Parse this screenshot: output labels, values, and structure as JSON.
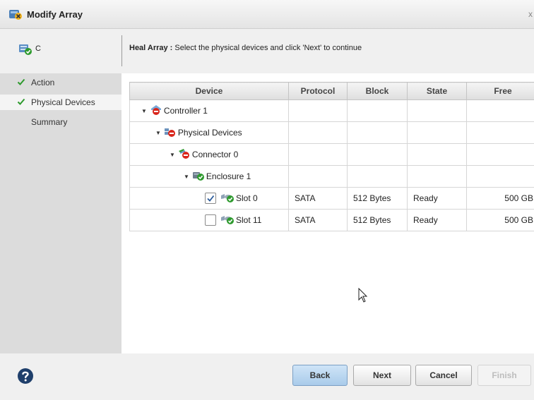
{
  "window": {
    "title": "Modify Array",
    "close_glyph": "x"
  },
  "controller": {
    "name": "C"
  },
  "instruction": {
    "bold": "Heal Array :",
    "text": " Select the physical devices and click 'Next' to continue"
  },
  "sidebar": {
    "items": [
      {
        "label": "Action",
        "checked": true
      },
      {
        "label": "Physical Devices",
        "checked": true
      },
      {
        "label": "Summary",
        "checked": false
      }
    ]
  },
  "table": {
    "columns": [
      "Device",
      "Protocol",
      "Block",
      "State",
      "Free"
    ],
    "rows": [
      {
        "label": "Controller 1",
        "icon": "controller-icon"
      },
      {
        "label": "Physical Devices",
        "icon": "physical-devices-icon"
      },
      {
        "label": "Connector 0",
        "icon": "connector-icon"
      },
      {
        "label": "Enclosure 1",
        "icon": "enclosure-icon"
      },
      {
        "label": "Slot 0",
        "icon": "disk-icon",
        "checked": true,
        "protocol": "SATA",
        "block": "512 Bytes",
        "state": "Ready",
        "free": "500 GB"
      },
      {
        "label": "Slot 11",
        "icon": "disk-icon",
        "checked": false,
        "protocol": "SATA",
        "block": "512 Bytes",
        "state": "Ready",
        "free": "500 GB"
      }
    ]
  },
  "buttons": {
    "back": "Back",
    "next": "Next",
    "cancel": "Cancel",
    "finish": "Finish"
  },
  "colors": {
    "accent": "#a9cbea",
    "sidebar": "#dcdcdc",
    "check": "#2e9a2e",
    "error": "#d9261c"
  }
}
